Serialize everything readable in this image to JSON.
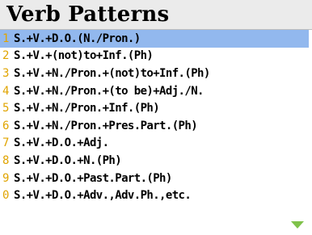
{
  "header": {
    "title": "Verb Patterns"
  },
  "list": {
    "items": [
      {
        "num": "1",
        "text": "S.+V.+D.O.(N./Pron.)",
        "selected": true
      },
      {
        "num": "2",
        "text": "S.+V.+(not)to+Inf.(Ph)"
      },
      {
        "num": "3",
        "text": "S.+V.+N./Pron.+(not)to+Inf.(Ph)"
      },
      {
        "num": "4",
        "text": "S.+V.+N./Pron.+(to be)+Adj./N."
      },
      {
        "num": "5",
        "text": "S.+V.+N./Pron.+Inf.(Ph)"
      },
      {
        "num": "6",
        "text": "S.+V.+N./Pron.+Pres.Part.(Ph)"
      },
      {
        "num": "7",
        "text": "S.+V.+D.O.+Adj."
      },
      {
        "num": "8",
        "text": "S.+V.+D.O.+N.(Ph)"
      },
      {
        "num": "9",
        "text": "S.+V.+D.O.+Past.Part.(Ph)"
      },
      {
        "num": "0",
        "text": "S.+V.+D.O.+Adv.,Adv.Ph.,etc."
      }
    ]
  },
  "colors": {
    "selection": "#92b8ee",
    "number": "#e0a400",
    "arrow": "#7fc24a"
  },
  "icons": {
    "more": "triangle-down-icon"
  }
}
